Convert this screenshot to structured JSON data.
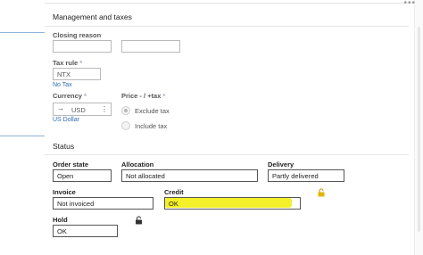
{
  "management": {
    "section_title": "Management and taxes",
    "closing_reason": {
      "label": "Closing reason",
      "value": "",
      "value2": ""
    },
    "tax_rule": {
      "label": "Tax rule",
      "required_mark": "*",
      "value": "NTX",
      "link": "No Tax"
    },
    "currency": {
      "label": "Currency",
      "required_mark": "*",
      "value": "USD",
      "link": "US Dollar"
    },
    "price_tax": {
      "label": "Price - / +tax",
      "required_mark": "*",
      "options": [
        {
          "label": "Exclude tax",
          "checked": true
        },
        {
          "label": "Include tax",
          "checked": false
        }
      ]
    }
  },
  "status": {
    "section_title": "Status",
    "order_state": {
      "label": "Order state",
      "value": "Open"
    },
    "allocation": {
      "label": "Allocation",
      "value": "Not allocated"
    },
    "delivery": {
      "label": "Delivery",
      "value": "Partly delivered"
    },
    "invoice": {
      "label": "Invoice",
      "value": "Not invoiced"
    },
    "credit": {
      "label": "Credit",
      "value": "OK"
    },
    "hold": {
      "label": "Hold",
      "value": "OK"
    }
  },
  "colors": {
    "link": "#2a6cb5",
    "highlight": "#f2ee1e",
    "lock_yellow": "#e0b400"
  },
  "icons": {
    "currency_prefix": "arrow-right-icon",
    "currency_menu": "kebab-icon",
    "credit_lock": "padlock-icon",
    "hold_lock": "padlock-icon"
  }
}
